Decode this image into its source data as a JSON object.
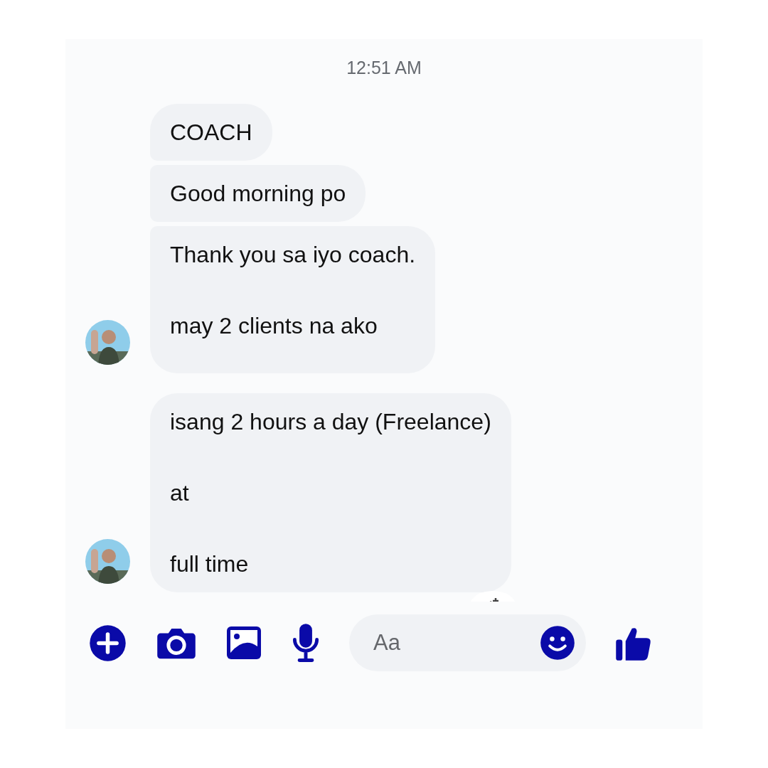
{
  "timestamp": "12:51 AM",
  "groups": [
    {
      "avatar": {
        "kind": "picture"
      },
      "messages": [
        "COACH",
        "Good morning po",
        "Thank you sa iyo coach.\n\nmay 2 clients na ako"
      ]
    },
    {
      "avatar": {
        "kind": "picture"
      },
      "messages": [
        "isang 2 hours a day (Freelance)\n\nat\n\nfull time"
      ]
    }
  ],
  "composer": {
    "placeholder": "Aa"
  }
}
